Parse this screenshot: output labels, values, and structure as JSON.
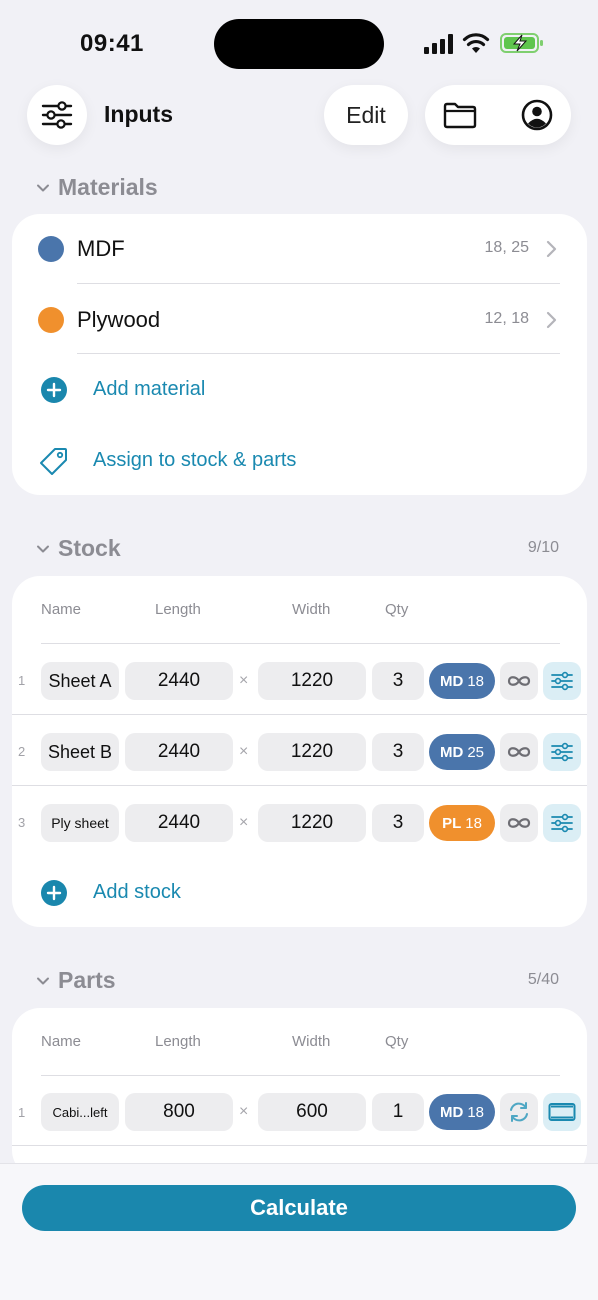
{
  "status": {
    "time": "09:41"
  },
  "header": {
    "title": "Inputs",
    "edit_label": "Edit"
  },
  "materials": {
    "title": "Materials",
    "items": [
      {
        "name": "MDF",
        "thickness": "18, 25",
        "color": "#4a75ab"
      },
      {
        "name": "Plywood",
        "thickness": "12, 18",
        "color": "#f0902d"
      }
    ],
    "add_label": "Add material",
    "assign_label": "Assign to stock & parts"
  },
  "stock": {
    "title": "Stock",
    "count": "9/10",
    "columns": [
      "Name",
      "Length",
      "Width",
      "Qty"
    ],
    "rows": [
      {
        "num": "1",
        "name": "Sheet A",
        "length": "2440",
        "width": "1220",
        "qty": "3",
        "mat_code": "MD",
        "mat_thick": "18",
        "mat_color": "#4a75ab"
      },
      {
        "num": "2",
        "name": "Sheet B",
        "length": "2440",
        "width": "1220",
        "qty": "3",
        "mat_code": "MD",
        "mat_thick": "25",
        "mat_color": "#4a75ab"
      },
      {
        "num": "3",
        "name": "Ply sheet",
        "length": "2440",
        "width": "1220",
        "qty": "3",
        "mat_code": "PL",
        "mat_thick": "18",
        "mat_color": "#f0902d"
      }
    ],
    "add_label": "Add stock"
  },
  "parts": {
    "title": "Parts",
    "count": "5/40",
    "columns": [
      "Name",
      "Length",
      "Width",
      "Qty"
    ],
    "rows": [
      {
        "num": "1",
        "name": "Cabi...left",
        "length": "800",
        "width": "600",
        "qty": "1",
        "mat_code": "MD",
        "mat_thick": "18",
        "mat_color": "#4a75ab"
      }
    ]
  },
  "times_symbol": "×",
  "calculate_label": "Calculate",
  "accent_color": "#1a87ad"
}
